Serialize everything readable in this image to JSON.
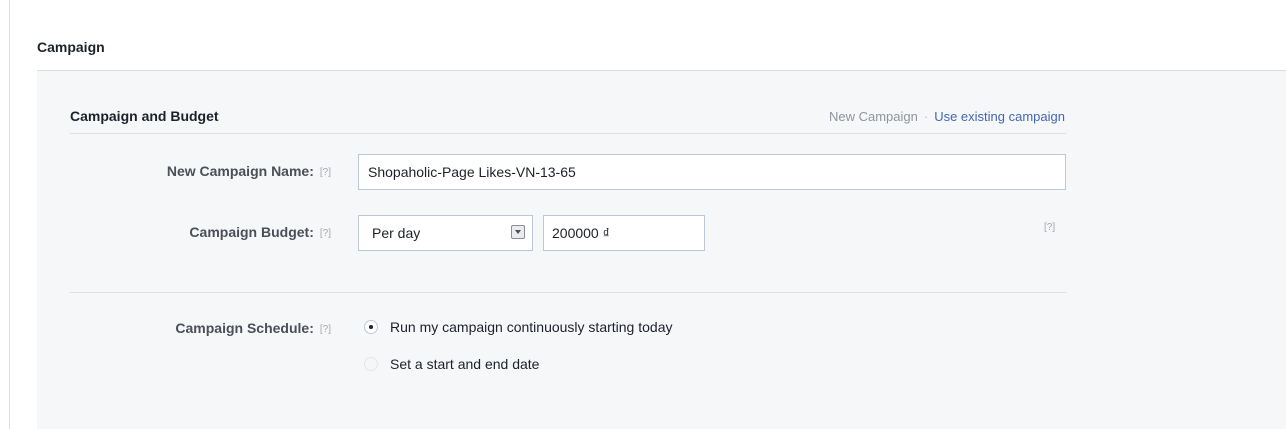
{
  "section": {
    "title": "Campaign"
  },
  "card": {
    "title": "Campaign and Budget",
    "new_campaign_label": "New Campaign",
    "separator": "·",
    "use_existing_label": "Use existing campaign"
  },
  "help_label": "[?]",
  "fields": {
    "name": {
      "label": "New Campaign Name:",
      "value": "Shopaholic-Page Likes-VN-13-65"
    },
    "budget": {
      "label": "Campaign Budget:",
      "period": "Per day",
      "amount": "200000 ₫"
    },
    "schedule": {
      "label": "Campaign Schedule:",
      "options": [
        {
          "label": "Run my campaign continuously starting today",
          "selected": true
        },
        {
          "label": "Set a start and end date",
          "selected": false
        }
      ]
    }
  },
  "colors": {
    "link": "#4267b2",
    "panel_bg": "#f6f7f9",
    "border": "#bdc7d8"
  }
}
